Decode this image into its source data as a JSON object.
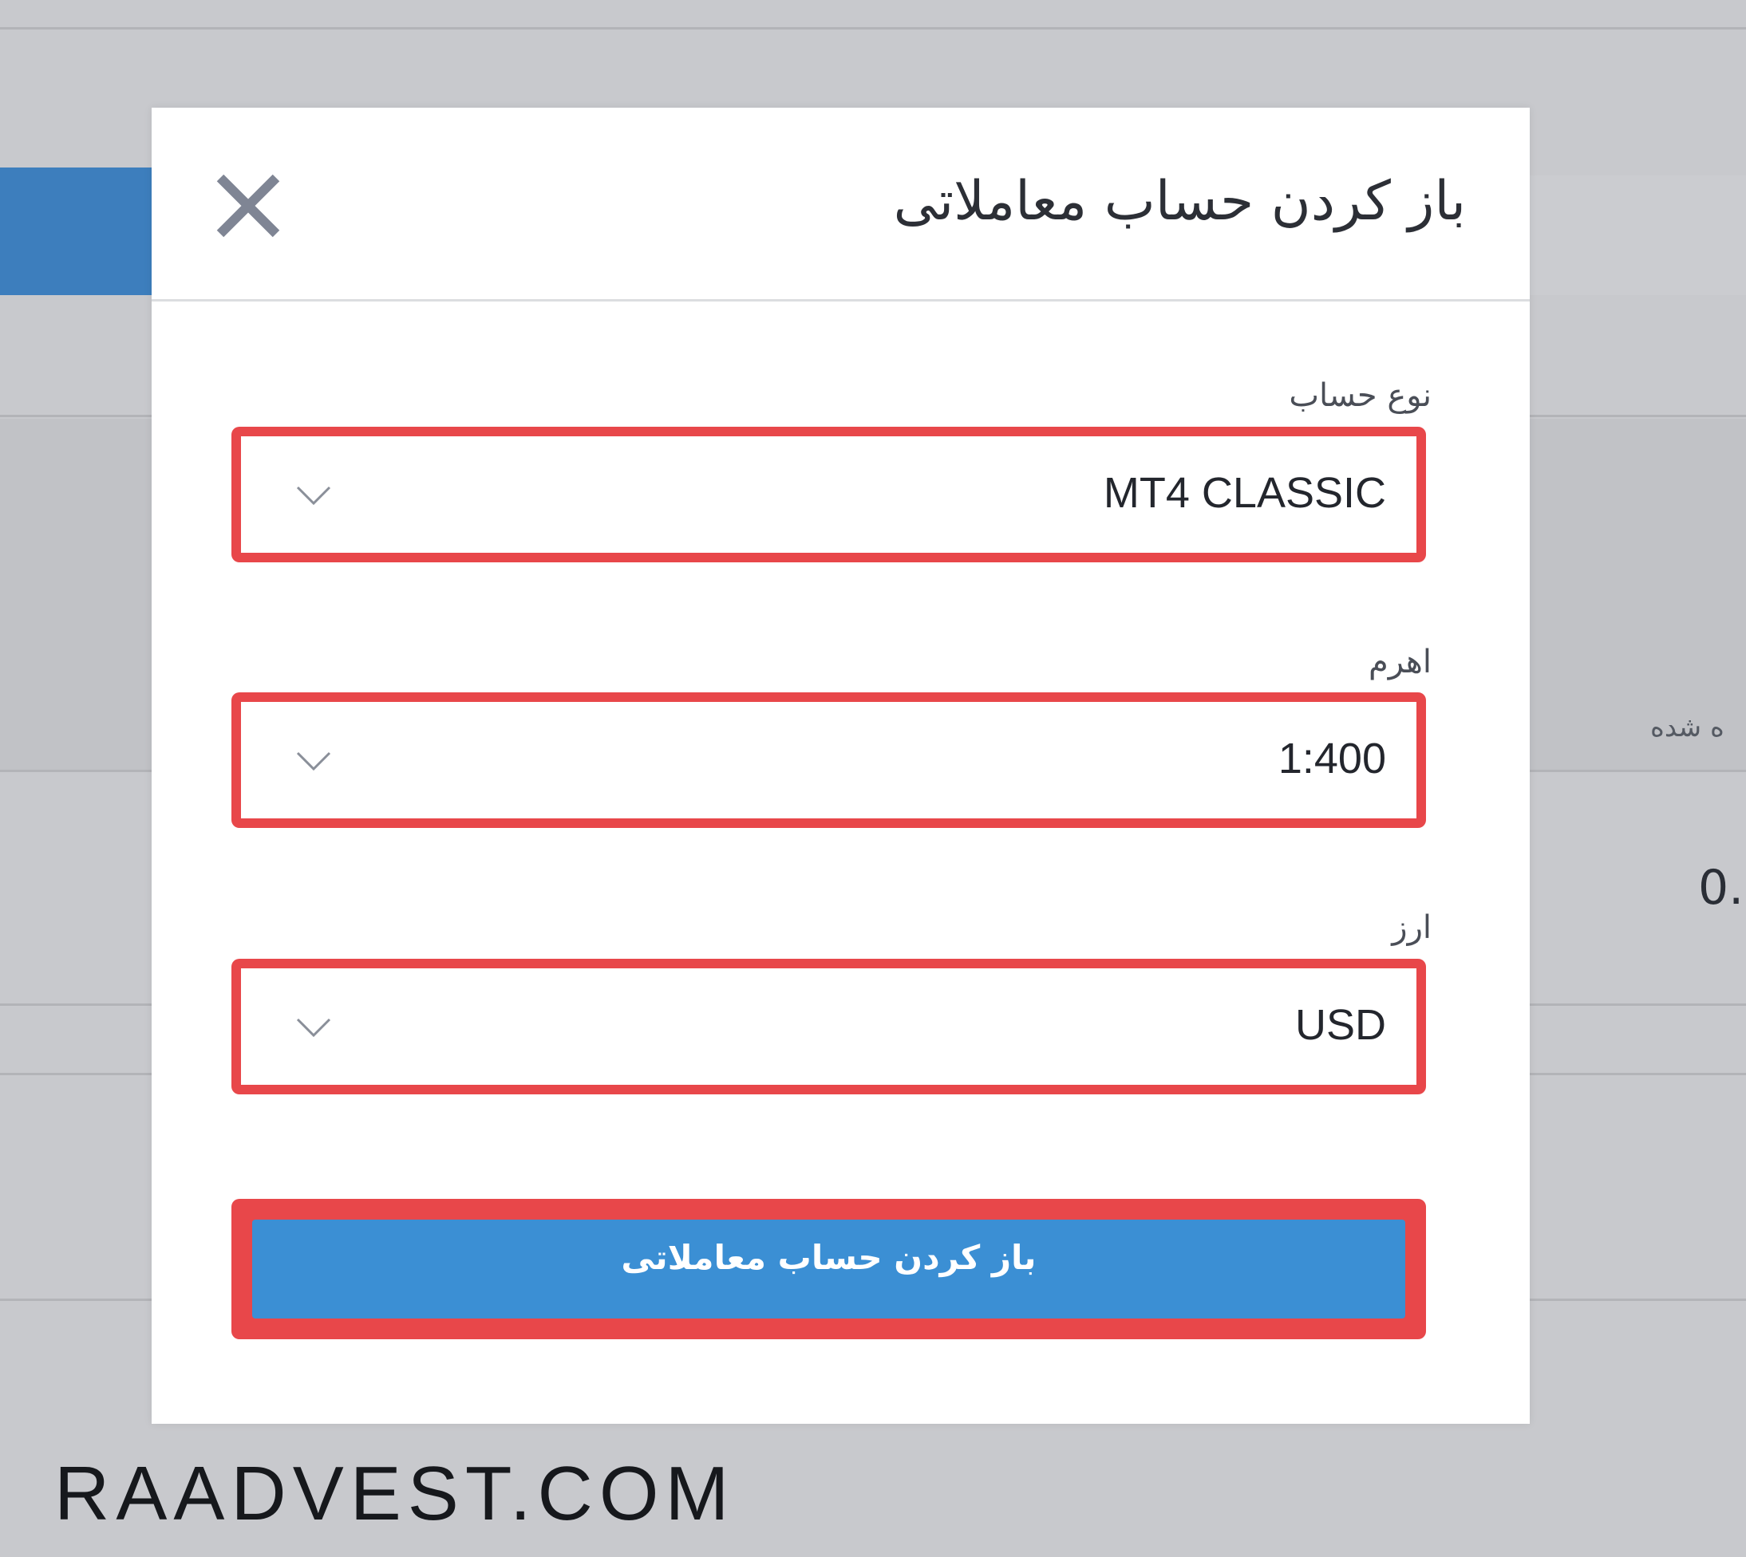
{
  "modal": {
    "title": "باز کردن حساب معاملاتی",
    "close_icon": "close-icon"
  },
  "form": {
    "account_type": {
      "label": "نوع حساب",
      "value": "MT4 CLASSIC"
    },
    "leverage": {
      "label": "اهرم",
      "value": "1:400"
    },
    "currency": {
      "label": "ارز",
      "value": "USD"
    },
    "submit_label": "باز کردن حساب معاملاتی"
  },
  "background": {
    "partial_label": "ه شده",
    "partial_value": "0."
  },
  "watermark": "RAADVEST.COM",
  "colors": {
    "highlight_border": "#e8474a",
    "submit_button": "#3b8fd4",
    "blue_tab": "#3d7ebd",
    "backdrop": "#c8c9cd"
  },
  "icons": {
    "close": "close-icon",
    "dropdown": "chevron-down-icon"
  }
}
